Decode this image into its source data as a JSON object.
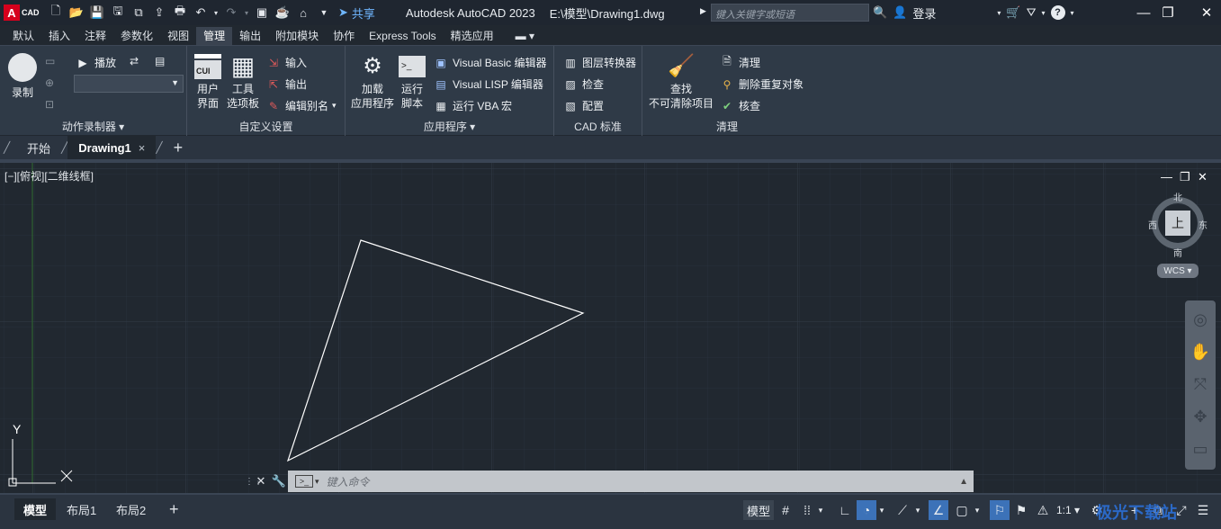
{
  "titlebar": {
    "logo_letter": "A",
    "logo_text": "CAD",
    "share_label": "共享",
    "app_title": "Autodesk AutoCAD 2023",
    "file_path": "E:\\模型\\Drawing1.dwg",
    "search_placeholder": "键入关键字或短语",
    "login_label": "登录",
    "help_icon": "?"
  },
  "ribbon_tabs": [
    "默认",
    "插入",
    "注释",
    "参数化",
    "视图",
    "管理",
    "输出",
    "附加模块",
    "协作",
    "Express Tools",
    "精选应用"
  ],
  "active_tab_index": 5,
  "ribbon": {
    "action_recorder": {
      "record_label": "录制",
      "play_label": "播放",
      "panel_label": "动作录制器"
    },
    "customization": {
      "user_interface_line1": "用户",
      "user_interface_line2": "界面",
      "cui_badge": "CUI",
      "tool_palettes_line1": "工具",
      "tool_palettes_line2": "选项板",
      "import_label": "输入",
      "export_label": "输出",
      "edit_aliases_label": "编辑别名",
      "panel_label": "自定义设置"
    },
    "applications": {
      "load_app_line1": "加载",
      "load_app_line2": "应用程序",
      "run_script_line1": "运行",
      "run_script_line2": "脚本",
      "vb_editor": "Visual Basic 编辑器",
      "vlisp_editor": "Visual LISP 编辑器",
      "run_vba": "运行 VBA 宏",
      "panel_label": "应用程序"
    },
    "cad_standards": {
      "layer_translator": "图层转换器",
      "check": "检查",
      "configure": "配置",
      "panel_label": "CAD 标准"
    },
    "cleanup": {
      "find_line1": "查找",
      "find_line2": "不可清除项目",
      "purge": "清理",
      "overkill": "删除重复对象",
      "audit": "核查",
      "panel_label": "清理"
    }
  },
  "doc_tabs": {
    "start": "开始",
    "drawing": "Drawing1",
    "close": "×",
    "add": "+"
  },
  "viewport": {
    "label": "[−][俯视][二维线框]",
    "viewcube": {
      "face": "上",
      "north": "北",
      "south": "南",
      "east": "东",
      "west": "西",
      "wcs": "WCS"
    },
    "ucs_y": "Y",
    "ucs_x": "X"
  },
  "command": {
    "placeholder": "键入命令"
  },
  "statusbar": {
    "layout_tabs": [
      "模型",
      "布局1",
      "布局2"
    ],
    "add": "+",
    "model_label": "模型",
    "scale": "1:1"
  },
  "watermark": "极光下载站"
}
